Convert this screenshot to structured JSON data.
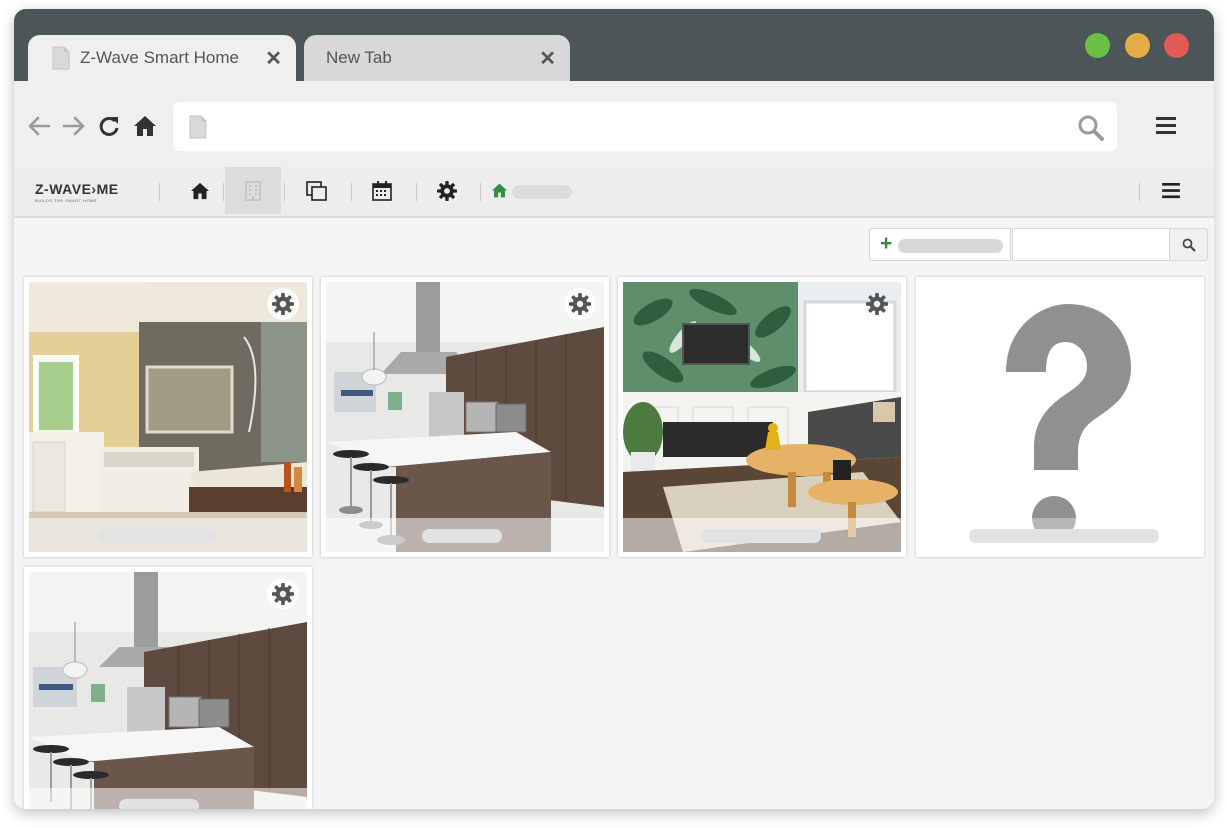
{
  "browser": {
    "tabs": [
      {
        "label": "Z-Wave Smart Home",
        "close_icon": "close-icon"
      },
      {
        "label": "New Tab",
        "close_icon": "close-icon"
      }
    ],
    "window_controls": {
      "colors": [
        "#6cbf45",
        "#e3ac46",
        "#e15a54"
      ]
    },
    "address_bar": {
      "value": ""
    }
  },
  "app": {
    "logo": {
      "main": "Z-WAVE›ME",
      "sub": "BUILDS THE SMART HOME"
    },
    "nav_icons": [
      "home-icon",
      "building-icon",
      "copy-icon",
      "calendar-icon",
      "gear-icon"
    ],
    "accent_color": "#2f8f3a"
  },
  "content": {
    "search": {
      "value": ""
    },
    "rooms": [
      {
        "image": "bathroom",
        "has_settings": true
      },
      {
        "image": "kitchen",
        "has_settings": true
      },
      {
        "image": "living-room",
        "has_settings": true
      },
      {
        "image": "unknown",
        "has_settings": false
      },
      {
        "image": "kitchen",
        "has_settings": true
      }
    ]
  }
}
